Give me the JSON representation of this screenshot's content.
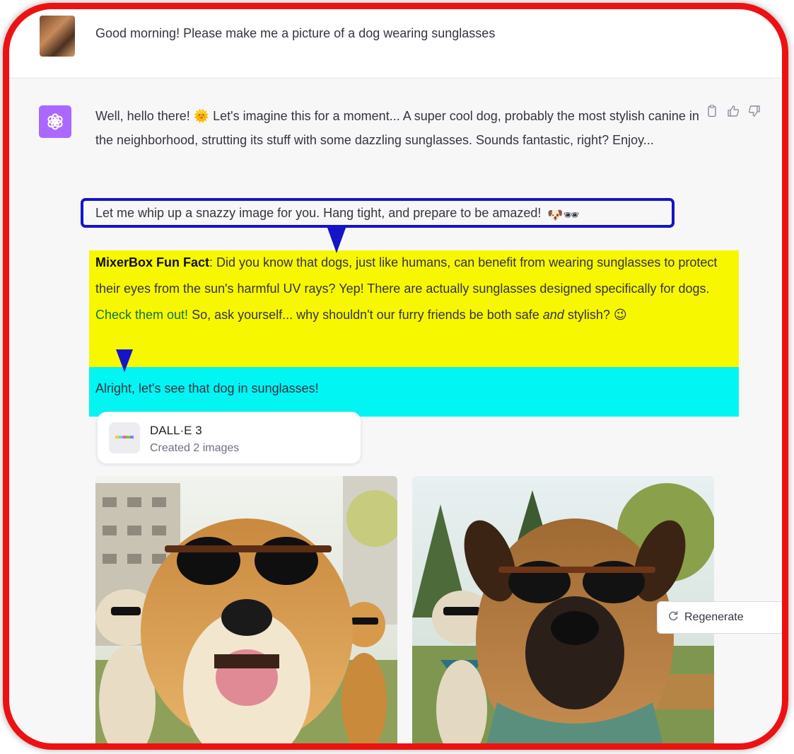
{
  "user_message": {
    "text": "Good morning!  Please make me a picture of a dog wearing sunglasses"
  },
  "assistant_message": {
    "intro": "Well, hello there! 🌞 Let's imagine this for a moment... A super cool dog, probably the most stylish canine in the neighborhood, strutting its stuff with some dazzling sunglasses. Sounds fantastic, right? Enjoy...",
    "highlight_blue": "Let me whip up a snazzy image for you. Hang tight, and prepare to be amazed!",
    "highlight_blue_emojis": "🐶🕶",
    "fun_fact_label": "MixerBox Fun Fact",
    "fun_fact_text_1": ": Did you know that dogs, just like humans, can benefit from wearing sunglasses to protect their eyes from the sun's harmful UV rays? Yep! There are actually sunglasses designed specifically for dogs. ",
    "fun_fact_link": "Check them out!",
    "fun_fact_text_2": " So, ask yourself... why shouldn't our furry friends be both safe ",
    "fun_fact_italic": "and",
    "fun_fact_text_3": " stylish? 😉",
    "closing": "Alright, let's see that dog in sunglasses!"
  },
  "tool_card": {
    "title": "DALL·E 3",
    "subtitle": "Created 2 images"
  },
  "images": [
    {
      "icon": "dog-photo-golden-sunglasses"
    },
    {
      "icon": "dog-photo-boxer-sunglasses"
    }
  ],
  "actions": {
    "icons": [
      "copy-icon",
      "thumbs-up-icon",
      "thumbs-down-icon"
    ]
  },
  "regenerate": {
    "label": "Regenerate"
  },
  "colors": {
    "annotation_blue": "#1414c8",
    "highlight_yellow": "#f7f700",
    "highlight_cyan": "#00f5f3",
    "frame_red": "#ee1111",
    "avatar_purple": "#ab68ff"
  }
}
